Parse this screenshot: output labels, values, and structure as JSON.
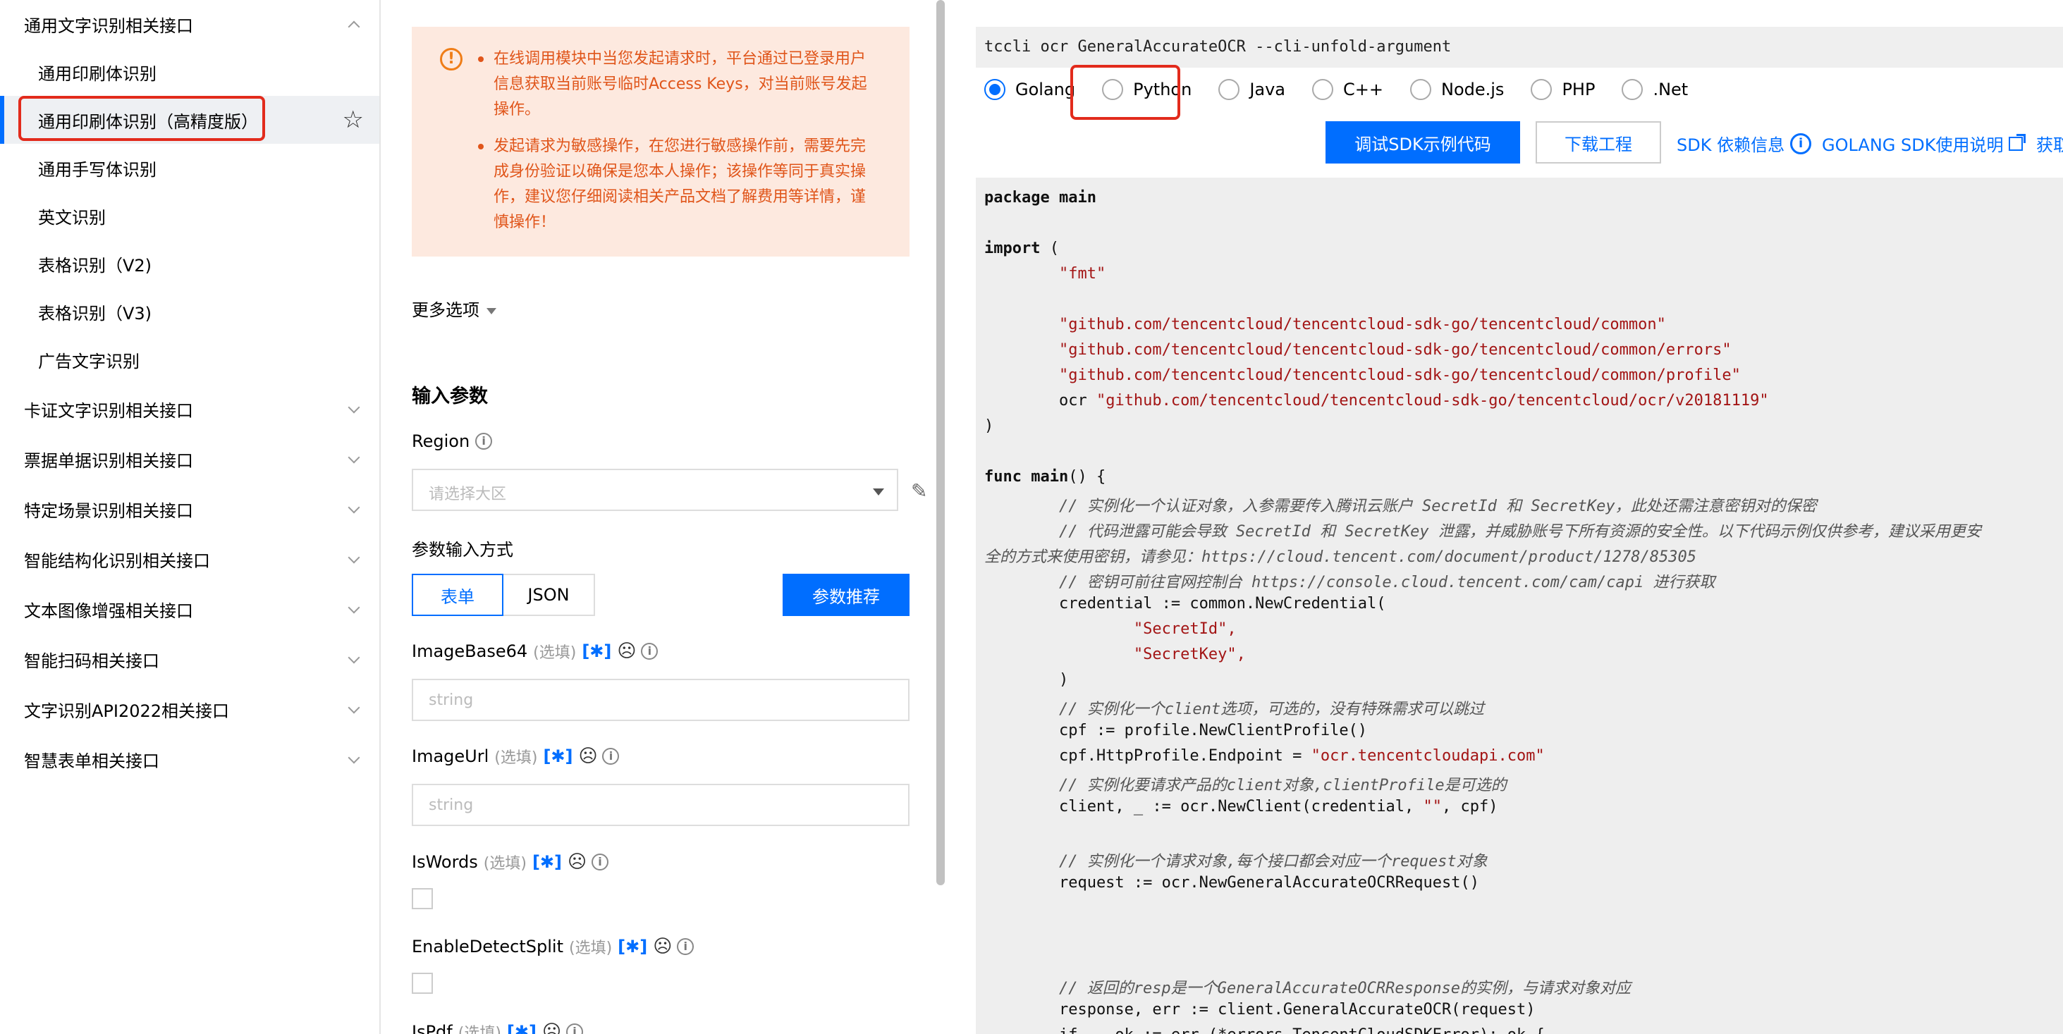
{
  "sidebar": {
    "group1_label": "通用文字识别相关接口",
    "sub_items": [
      "通用印刷体识别",
      "通用印刷体识别（高精度版）",
      "通用手写体识别",
      "英文识别",
      "表格识别（V2)",
      "表格识别（V3)",
      "广告文字识别"
    ],
    "groups": [
      "卡证文字识别相关接口",
      "票据单据识别相关接口",
      "特定场景识别相关接口",
      "智能结构化识别相关接口",
      "文本图像增强相关接口",
      "智能扫码相关接口",
      "文字识别API2022相关接口",
      "智慧表单相关接口"
    ]
  },
  "warning": {
    "items": [
      "在线调用模块中当您发起请求时，平台通过已登录用户信息获取当前账号临时Access Keys，对当前账号发起操作。",
      "发起请求为敏感操作，在您进行敏感操作前，需要先完成身份验证以确保是您本人操作；该操作等同于真实操作，建议您仔细阅读相关产品文档了解费用等详情，谨慎操作！"
    ]
  },
  "form": {
    "more_options": "更多选项",
    "section_title": "输入参数",
    "region_label": "Region",
    "region_placeholder": "请选择大区",
    "input_mode_label": "参数输入方式",
    "mode_form": "表单",
    "mode_json": "JSON",
    "recommend": "参数推荐",
    "optional": "(选填)",
    "bracket_icon": "[✱]",
    "params": [
      {
        "name": "ImageBase64",
        "placeholder": "string"
      },
      {
        "name": "ImageUrl",
        "placeholder": "string"
      },
      {
        "name": "IsWords"
      },
      {
        "name": "EnableDetectSplit"
      },
      {
        "name": "IsPdf"
      }
    ]
  },
  "right": {
    "cli": "tccli ocr GeneralAccurateOCR --cli-unfold-argument",
    "languages": [
      "Golang",
      "Python",
      "Java",
      "C++",
      "Node.js",
      "PHP",
      ".Net"
    ],
    "selected_language": "Golang",
    "sdk_button": "调试SDK示例代码",
    "download_button": "下载工程",
    "dep_link": "SDK 依赖信息",
    "usage_link": "GOLANG SDK使用说明",
    "get_link": "获取"
  },
  "code_lines": {
    "l1": "package main",
    "l2a": "import",
    "l2b": " (",
    "l3": "        \"fmt\"",
    "l4": "        \"github.com/tencentcloud/tencentcloud-sdk-go/tencentcloud/common\"",
    "l5": "        \"github.com/tencentcloud/tencentcloud-sdk-go/tencentcloud/common/errors\"",
    "l6": "        \"github.com/tencentcloud/tencentcloud-sdk-go/tencentcloud/common/profile\"",
    "l7a": "        ocr ",
    "l7b": "\"github.com/tencentcloud/tencentcloud-sdk-go/tencentcloud/ocr/v20181119\"",
    "l8": ")",
    "l9a": "func",
    "l9b": "main",
    "l9c": "() {",
    "c1": "        // 实例化一个认证对象，入参需要传入腾讯云账户 SecretId 和 SecretKey，此处还需注意密钥对的保密",
    "c2": "        // 代码泄露可能会导致 SecretId 和 SecretKey 泄露，并威胁账号下所有资源的安全性。以下代码示例仅供参考，建议采用更安",
    "c3": "全的方式来使用密钥，请参见：https://cloud.tencent.com/document/product/1278/85305",
    "c4": "        // 密钥可前往官网控制台 https://console.cloud.tencent.com/cam/capi 进行获取",
    "l10": "        credential := common.NewCredential(",
    "l11": "                \"SecretId\",",
    "l12": "                \"SecretKey\",",
    "l13": "        )",
    "c5": "        // 实例化一个client选项，可选的，没有特殊需求可以跳过",
    "l14": "        cpf := profile.NewClientProfile()",
    "l15a": "        cpf.HttpProfile.Endpoint = ",
    "l15b": "\"ocr.tencentcloudapi.com\"",
    "c6": "        // 实例化要请求产品的client对象,clientProfile是可选的",
    "l16a": "        client, _ := ocr.NewClient(credential, ",
    "l16b": "\"\"",
    "l16c": ", cpf)",
    "c7": "        // 实例化一个请求对象,每个接口都会对应一个request对象",
    "l17": "        request := ocr.NewGeneralAccurateOCRRequest()",
    "c8": "        // 返回的resp是一个GeneralAccurateOCRResponse的实例，与请求对象对应",
    "l18": "        response, err := client.GeneralAccurateOCR(request)",
    "l19": "        if _, ok := err.(*errors.TencentCloudSDKError); ok {"
  },
  "colors": {
    "accent": "#006eff",
    "highlight": "#e22b1c",
    "warning_bg": "#fde9df",
    "warning_text": "#e0551a"
  }
}
